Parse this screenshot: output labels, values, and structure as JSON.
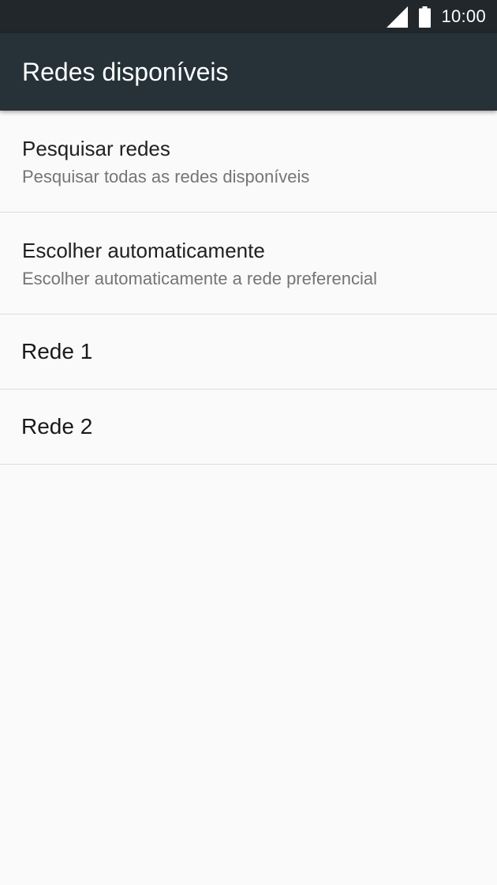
{
  "status_bar": {
    "time": "10:00",
    "icons": [
      "signal-icon",
      "battery-icon"
    ]
  },
  "app_bar": {
    "title": "Redes disponíveis"
  },
  "list": {
    "items": [
      {
        "primary": "Pesquisar redes",
        "secondary": "Pesquisar todas as redes disponíveis"
      },
      {
        "primary": "Escolher automaticamente",
        "secondary": "Escolher automaticamente a rede preferencial"
      },
      {
        "primary": "Rede 1"
      },
      {
        "primary": "Rede 2"
      }
    ]
  },
  "colors": {
    "status_bar": "#22272b",
    "app_bar": "#263238",
    "background": "#fafafa",
    "divider": "#dcdcdc",
    "primary_text": "#212121",
    "secondary_text": "#757575"
  }
}
